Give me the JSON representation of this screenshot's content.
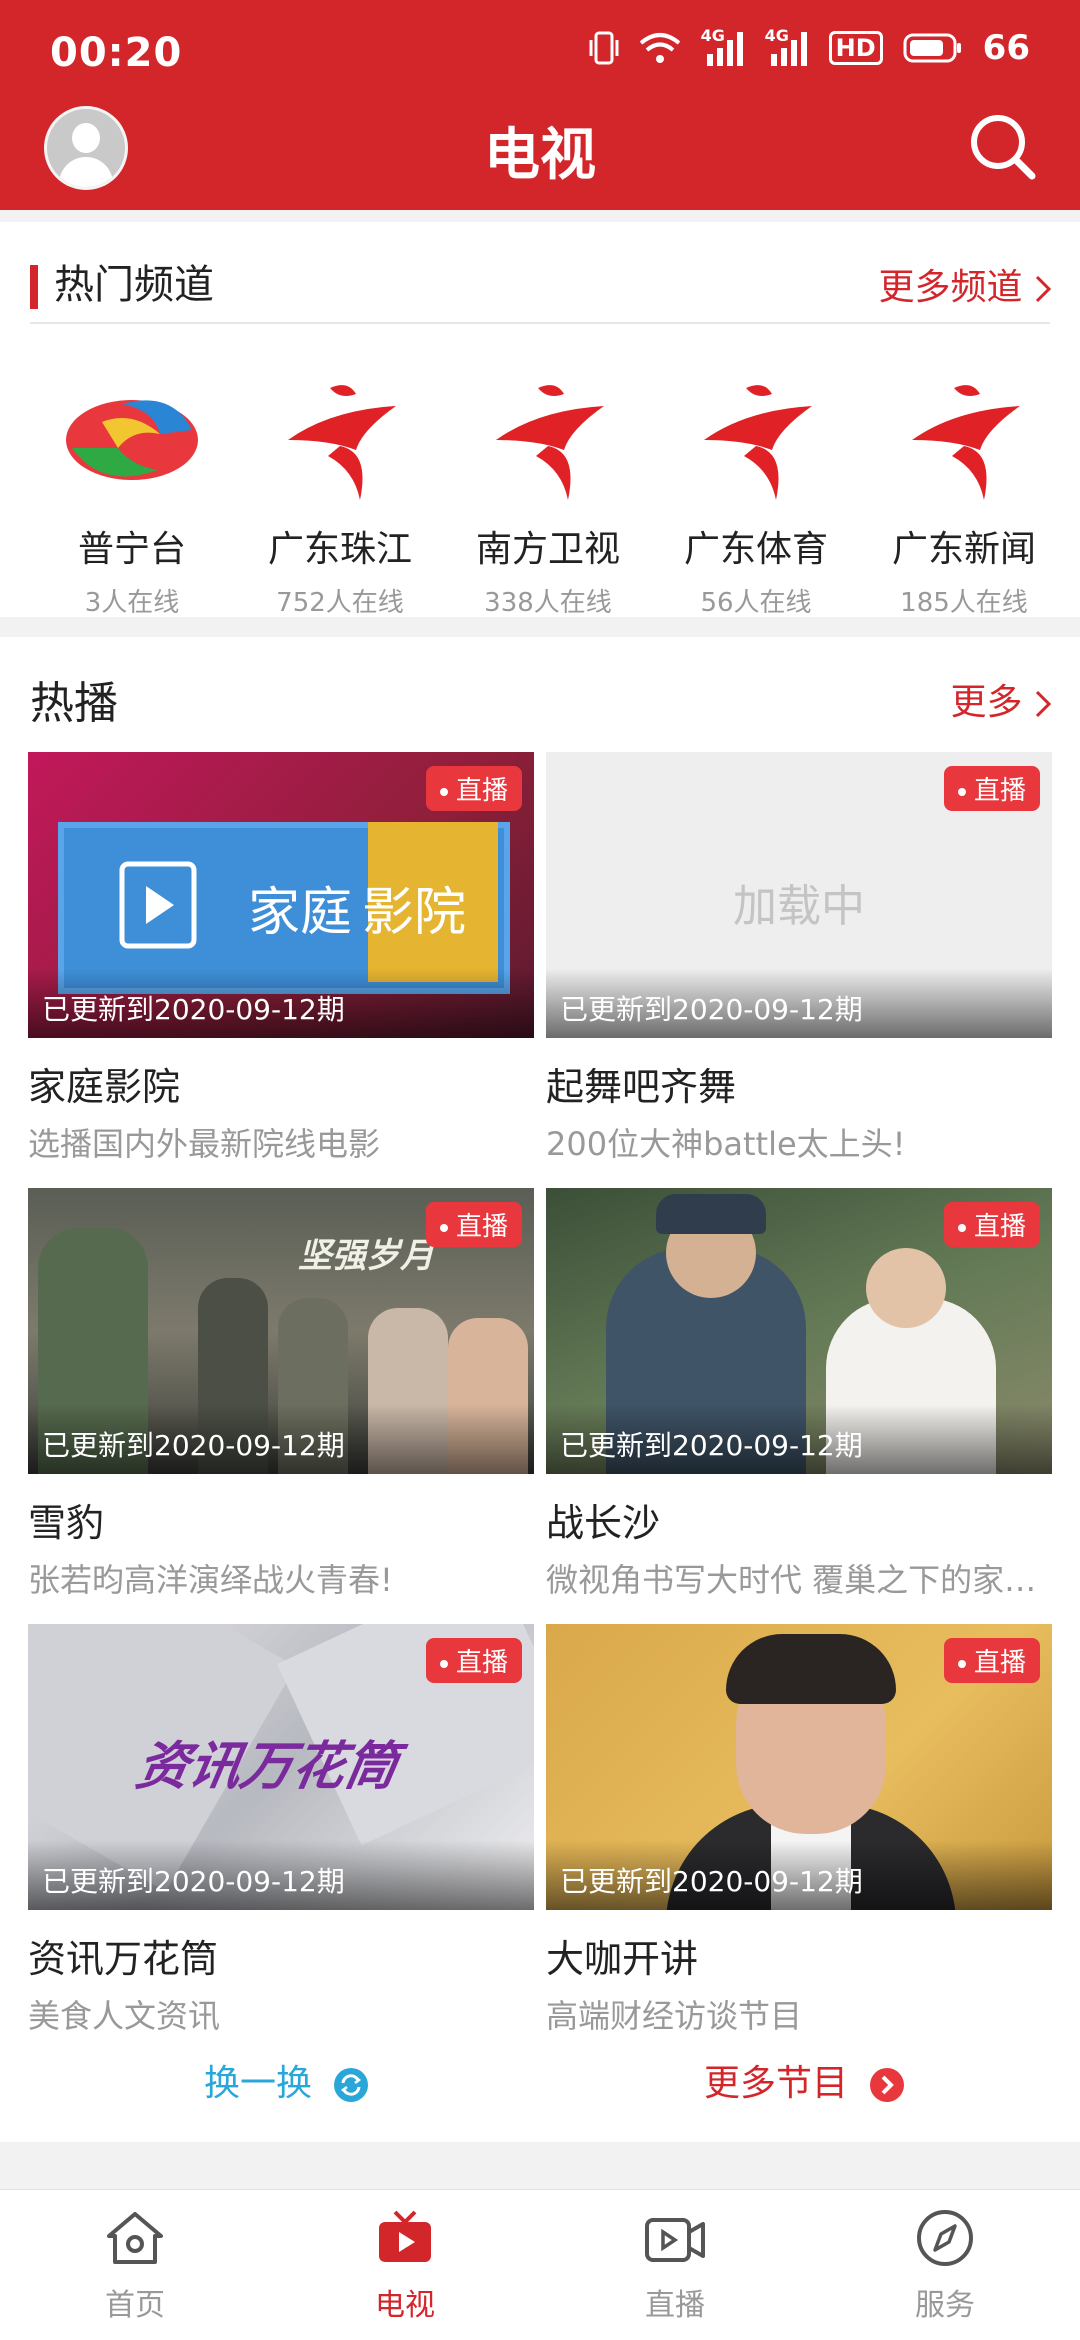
{
  "status_bar": {
    "time": "00:20",
    "net1": "4G",
    "net2": "4G",
    "hd": "HD",
    "battery": "66"
  },
  "header": {
    "title": "电视"
  },
  "hot_channels": {
    "title": "热门频道",
    "more": "更多频道",
    "items": [
      {
        "name": "普宁台",
        "online": "3人在线",
        "logo": "puning-logo"
      },
      {
        "name": "广东珠江",
        "online": "752人在线",
        "logo": "gdtv-logo"
      },
      {
        "name": "南方卫视",
        "online": "338人在线",
        "logo": "gdtv-logo"
      },
      {
        "name": "广东体育",
        "online": "56人在线",
        "logo": "gdtv-logo"
      },
      {
        "name": "广东新闻",
        "online": "185人在线",
        "logo": "gdtv-logo"
      }
    ]
  },
  "hot_play": {
    "title": "热播",
    "more": "更多",
    "items": [
      {
        "title": "家庭影院",
        "subtitle": "选播国内外最新院线电影",
        "badge": "直播",
        "updated": "已更新到2020-09-12期",
        "thumb_text1": "家庭",
        "thumb_text2": "影院"
      },
      {
        "title": "起舞吧齐舞",
        "subtitle": "200位大神battle太上头!",
        "badge": "直播",
        "updated": "已更新到2020-09-12期",
        "thumb_text": "加载中"
      },
      {
        "title": "雪豹",
        "subtitle": "张若昀高洋演绎战火青春!",
        "badge": "直播",
        "updated": "已更新到2020-09-12期",
        "thumb_text": "坚强岁月"
      },
      {
        "title": "战长沙",
        "subtitle": "微视角书写大时代 覆巢之下的家…",
        "badge": "直播",
        "updated": "已更新到2020-09-12期"
      },
      {
        "title": "资讯万花筒",
        "subtitle": "美食人文资讯",
        "badge": "直播",
        "updated": "已更新到2020-09-12期",
        "thumb_text": "资讯万花筒"
      },
      {
        "title": "大咖开讲",
        "subtitle": "高端财经访谈节目",
        "badge": "直播",
        "updated": "已更新到2020-09-12期"
      }
    ]
  },
  "actions": {
    "refresh": "换一换",
    "more_programs": "更多节目"
  },
  "tabbar": [
    {
      "label": "首页",
      "icon": "home-icon",
      "active": false
    },
    {
      "label": "电视",
      "icon": "tv-icon",
      "active": true
    },
    {
      "label": "直播",
      "icon": "live-video-icon",
      "active": false
    },
    {
      "label": "服务",
      "icon": "compass-icon",
      "active": false
    }
  ],
  "colors": {
    "brand": "#d3262b",
    "refresh": "#2aa7d8"
  }
}
